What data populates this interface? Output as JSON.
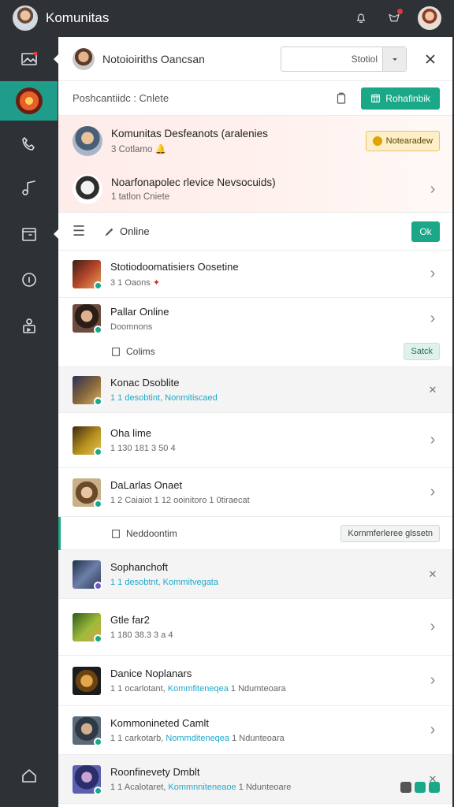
{
  "app": {
    "title": "Komunitas"
  },
  "header": {
    "name": "Notoioiriths Oancsan",
    "search_value": "Stotiol",
    "status_text": "Poshcantiidc : Cnlete",
    "primary_button": "Rohafinbik"
  },
  "pinned": [
    {
      "title": "Komunitas Desfeanots (aralenies",
      "sub": "3  Cotlamo",
      "button": "Notearadew"
    },
    {
      "title": "Noarfonapolec rlevice Nevsocuids)",
      "sub": "1 tatlon  Cniete"
    }
  ],
  "toolbar": {
    "filter_label": "Online",
    "ok_button": "Ok"
  },
  "items": [
    {
      "title": "Stotiodoomatisiers Oosetine",
      "sub": "3  1 Oaons"
    },
    {
      "title": "Pallar Online",
      "sub": "Doomnons",
      "sub_row": "Colims",
      "sub_button": "Satck"
    },
    {
      "title": "Konac Dsoblite",
      "sub_a": "1 1 desobtint,",
      "sub_link": "Nonmitiscaed"
    },
    {
      "title": "Oha lime",
      "sub": "1 130  181 3 50 4"
    },
    {
      "title": "DaLarlas Onaet",
      "sub": "1  2 Caiaiot   1 12 ooinitoro   1 0tiraecat",
      "sub_row": "Neddoontim",
      "sub_button": "Kornmferleree glssetn"
    },
    {
      "title": "Sophanchoft",
      "sub_a": "1 1 desobtnt,",
      "sub_link": "Kommitvegata"
    },
    {
      "title": "Gtle far2",
      "sub": "1 180  38.3 3 a 4"
    },
    {
      "title": "Danice Noplanars",
      "sub_a": "1 1 ocarlotant,",
      "sub_link": "Kommfiteneqea",
      "sub_b": "1 Ndumteoara"
    },
    {
      "title": "Kommonineted Camlt",
      "sub_a": "1 1 carkotarb,",
      "sub_link": "Nommditeneqea",
      "sub_b": "1 Ndunteoara"
    },
    {
      "title": "Roonfinevety Dmblt",
      "sub_a": "1 1 Acalotaret,",
      "sub_link": "Kommnniteneaoe",
      "sub_b": "1 Ndunteoare"
    }
  ],
  "colors": {
    "accent": "#1aa889",
    "sidebar": "#2e3236",
    "link": "#1ea9c9",
    "pinned_bg": "#fdecea"
  }
}
